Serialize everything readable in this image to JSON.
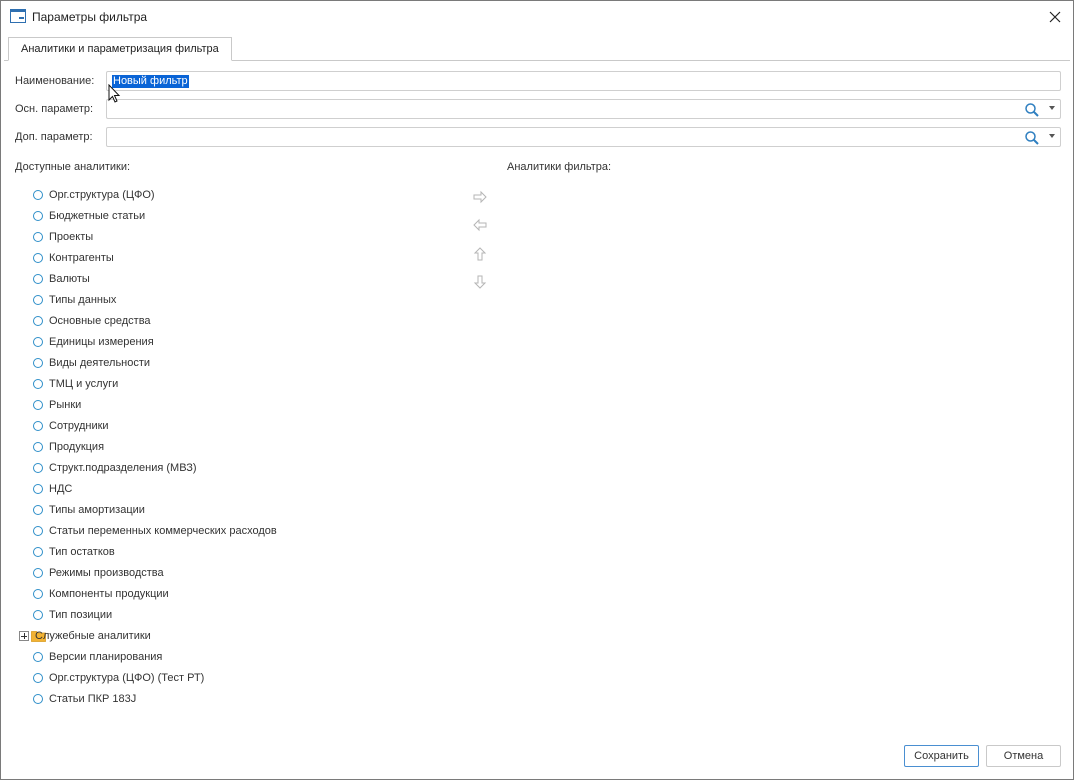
{
  "window": {
    "title": "Параметры фильтра"
  },
  "tabs": [
    {
      "label": "Аналитики и параметризация фильтра"
    }
  ],
  "form": {
    "name_label": "Наименование:",
    "name_value": "Новый фильтр",
    "main_param_label": "Осн. параметр:",
    "main_param_value": "",
    "extra_param_label": "Доп. параметр:",
    "extra_param_value": ""
  },
  "available": {
    "heading": "Доступные аналитики:",
    "items": [
      "Орг.структура (ЦФО)",
      "Бюджетные статьи",
      "Проекты",
      "Контрагенты",
      "Валюты",
      "Типы данных",
      "Основные средства",
      "Единицы измерения",
      "Виды деятельности",
      "ТМЦ и услуги",
      "Рынки",
      "Сотрудники",
      "Продукция",
      "Структ.подразделения (МВЗ)",
      "НДС",
      "Типы амортизации",
      "Статьи переменных коммерческих расходов",
      "Тип остатков",
      "Режимы производства",
      "Компоненты продукции",
      "Тип позиции",
      "Служебные аналитики",
      "Версии планирования",
      "Орг.структура (ЦФО) (Тест РТ)",
      "Статьи ПКР 183J"
    ],
    "folder_index": 21
  },
  "selected": {
    "heading": "Аналитики фильтра:"
  },
  "buttons": {
    "save": "Сохранить",
    "cancel": "Отмена"
  },
  "colors": {
    "accent": "#2f8fc9",
    "selection": "#0a64d6",
    "folder": "#f2b233"
  }
}
